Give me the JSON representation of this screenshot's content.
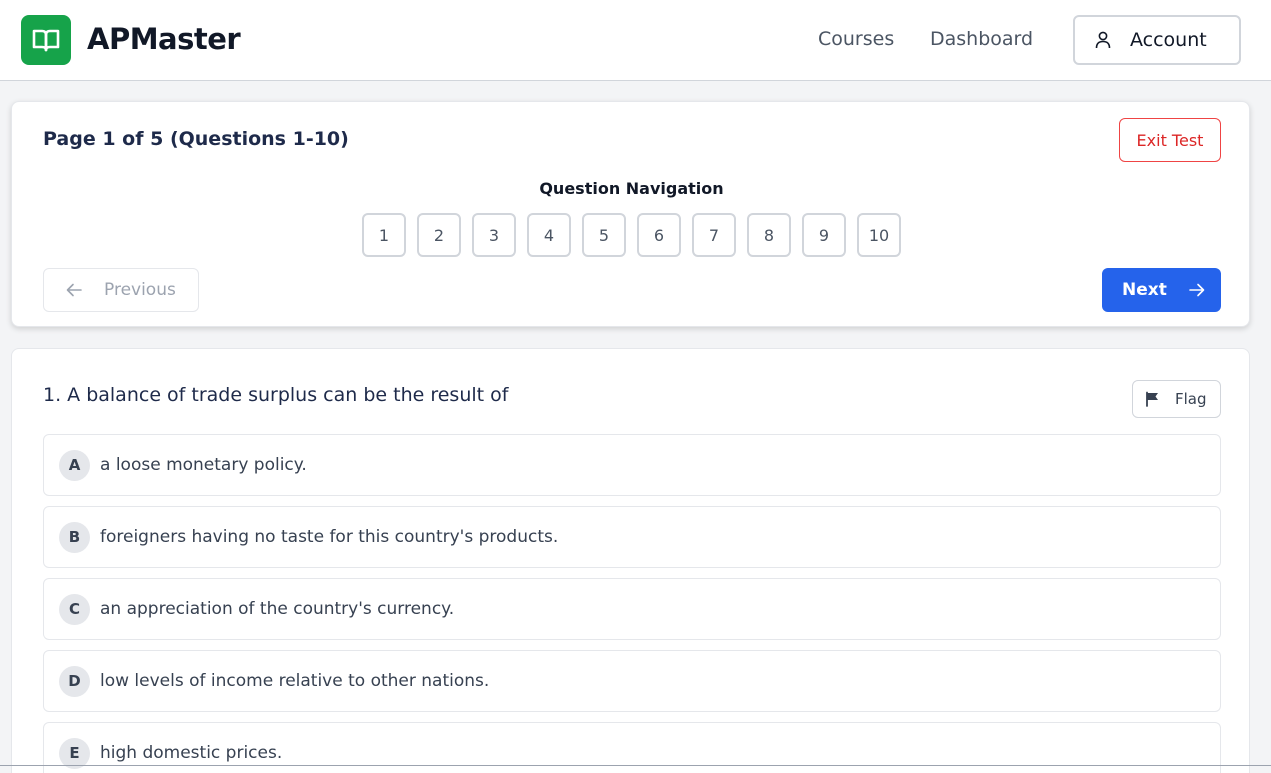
{
  "header": {
    "logo_text": "APMaster",
    "nav": {
      "courses": "Courses",
      "dashboard": "Dashboard"
    },
    "account_label": "Account"
  },
  "nav_card": {
    "page_title": "Page 1 of 5 (Questions 1-10)",
    "exit_label": "Exit Test",
    "question_nav_title": "Question Navigation",
    "question_numbers": [
      "1",
      "2",
      "3",
      "4",
      "5",
      "6",
      "7",
      "8",
      "9",
      "10"
    ],
    "previous_label": "Previous",
    "next_label": "Next"
  },
  "question": {
    "text": "1. A balance of trade surplus can be the result of",
    "flag_label": "Flag",
    "options": [
      {
        "letter": "A",
        "text": "a loose monetary policy."
      },
      {
        "letter": "B",
        "text": "foreigners having no taste for this country's products."
      },
      {
        "letter": "C",
        "text": "an appreciation of the country's currency."
      },
      {
        "letter": "D",
        "text": "low levels of income relative to other nations."
      },
      {
        "letter": "E",
        "text": "high domestic prices."
      }
    ]
  },
  "colors": {
    "brand": "#16a34a",
    "primary": "#2563eb",
    "danger": "#dc2626"
  },
  "icons": {
    "logo": "open-book-icon",
    "account": "user-icon",
    "previous": "arrow-left-icon",
    "next": "arrow-right-icon",
    "flag": "flag-icon"
  }
}
